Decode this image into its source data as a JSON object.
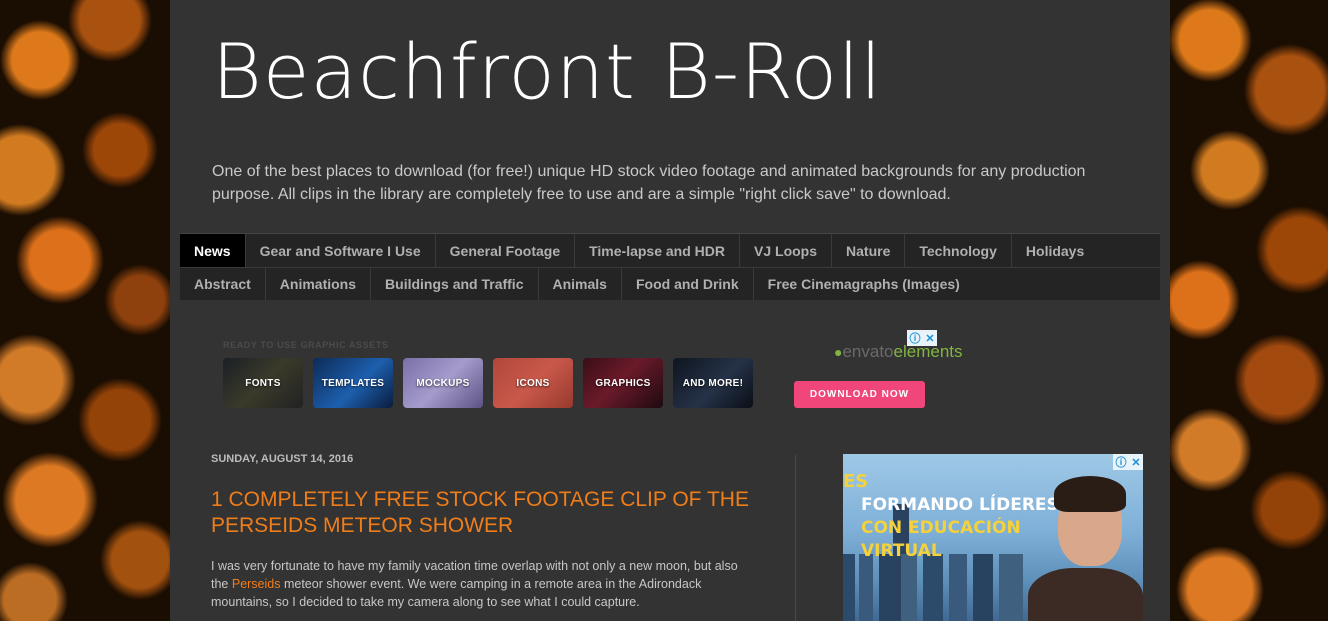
{
  "site": {
    "title": "Beachfront B-Roll",
    "description": "One of the best places to download (for free!) unique HD stock video footage and animated backgrounds for any production purpose. All clips in the library are completely free to use and are a simple \"right click save\" to download."
  },
  "nav": {
    "row1": [
      "News",
      "Gear and Software I Use",
      "General Footage",
      "Time-lapse and HDR",
      "VJ Loops",
      "Nature",
      "Technology",
      "Holidays"
    ],
    "row2": [
      "Abstract",
      "Animations",
      "Buildings and Traffic",
      "Animals",
      "Food and Drink",
      "Free Cinemagraphs (Images)"
    ],
    "active": "News"
  },
  "ad_top": {
    "label": "READY TO USE GRAPHIC ASSETS",
    "tiles": [
      "FONTS",
      "TEMPLATES",
      "MOCKUPS",
      "ICONS",
      "GRAPHICS",
      "AND MORE!"
    ],
    "logo_envato": "envato",
    "logo_elements": "elements",
    "button": "DOWNLOAD NOW"
  },
  "post": {
    "date": "SUNDAY, AUGUST 14, 2016",
    "title": "1 Completely Free Stock Footage Clip of the Perseids Meteor Shower",
    "body_before": "I was very fortunate to have my family vacation time overlap with not only a new moon, but also the ",
    "body_link": "Perseids",
    "body_after": " meteor shower event. We were camping in a remote area in the Adirondack mountains, so I decided to take my camera along to see what I could capture."
  },
  "side_ad": {
    "prefix": "ES",
    "line1": "FORMANDO LÍDERES",
    "line2": "CON EDUCACIÓN",
    "line3": "VIRTUAL"
  },
  "colors": {
    "accent": "#ef7d1a",
    "page_bg": "#333333",
    "nav_bg": "#242424",
    "button_pink": "#f0467a"
  }
}
